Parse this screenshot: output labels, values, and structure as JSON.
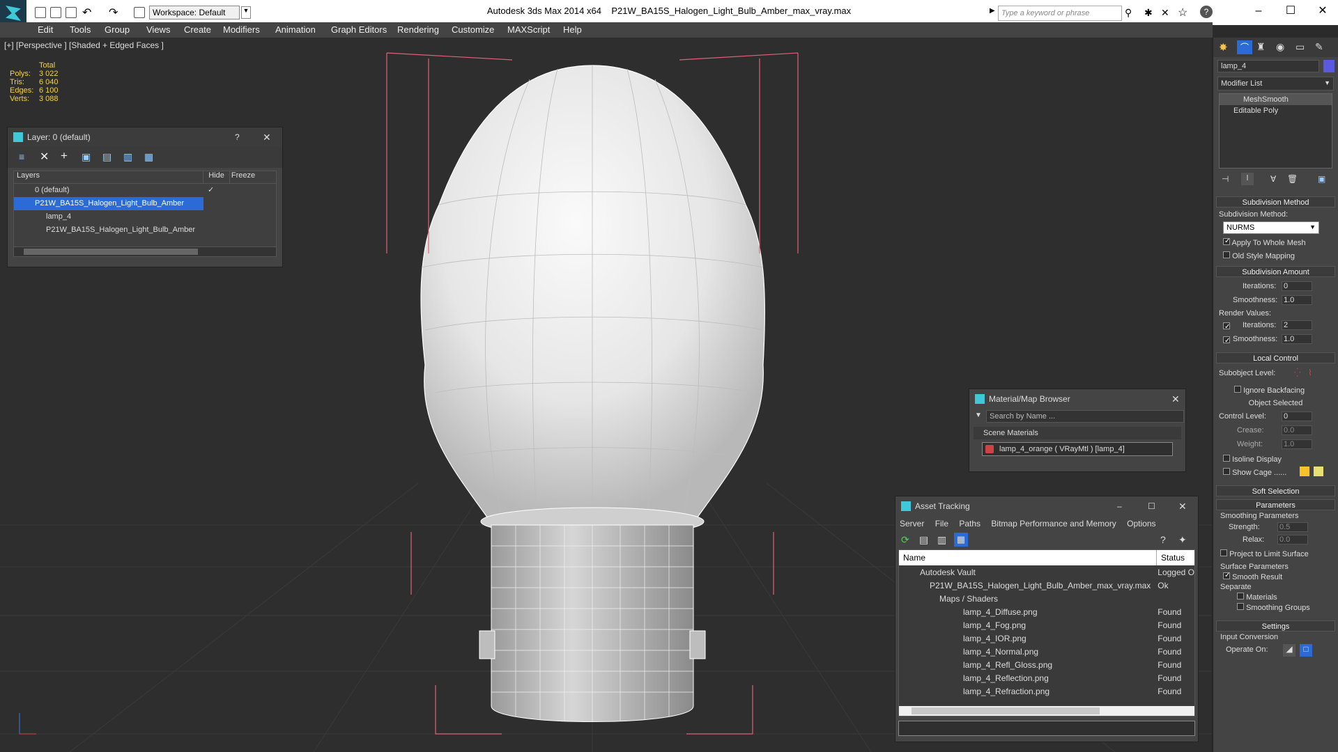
{
  "window": {
    "app_title": "Autodesk 3ds Max  2014 x64",
    "file_title": "P21W_BA15S_Halogen_Light_Bulb_Amber_max_vray.max",
    "workspace": "Workspace: Default",
    "search_placeholder": "Type a keyword or phrase"
  },
  "menubar": [
    "Edit",
    "Tools",
    "Group",
    "Views",
    "Create",
    "Modifiers",
    "Animation",
    "Graph Editors",
    "Rendering",
    "Customize",
    "MAXScript",
    "Help"
  ],
  "viewport": {
    "label": "[+] [Perspective ] [Shaded + Edged Faces ]",
    "stats": {
      "header": "Total",
      "rows": [
        {
          "label": "Polys:",
          "value": "3 022"
        },
        {
          "label": "Tris:",
          "value": "6 040"
        },
        {
          "label": "Edges:",
          "value": "6 100"
        },
        {
          "label": "Verts:",
          "value": "3 088"
        }
      ]
    }
  },
  "layer_dialog": {
    "title": "Layer: 0 (default)",
    "help": "?",
    "columns": [
      "Layers",
      "Hide",
      "Freeze"
    ],
    "rows": [
      {
        "name": "0 (default)"
      },
      {
        "name": "P21W_BA15S_Halogen_Light_Bulb_Amber"
      },
      {
        "name": "lamp_4"
      },
      {
        "name": "P21W_BA15S_Halogen_Light_Bulb_Amber"
      }
    ]
  },
  "material_browser": {
    "title": "Material/Map Browser",
    "search_placeholder": "Search by Name ...",
    "section": "Scene Materials",
    "item": "lamp_4_orange  ( VRayMtl )  [lamp_4]"
  },
  "asset_tracking": {
    "title": "Asset Tracking",
    "menu": [
      "Server",
      "File",
      "Paths",
      "Bitmap Performance and Memory",
      "Options"
    ],
    "columns": [
      "Name",
      "Status"
    ],
    "rows": [
      {
        "name": "Autodesk Vault",
        "status": "Logged O"
      },
      {
        "name": "P21W_BA15S_Halogen_Light_Bulb_Amber_max_vray.max",
        "status": "Ok"
      },
      {
        "name": "Maps / Shaders",
        "status": ""
      },
      {
        "name": "lamp_4_Diffuse.png",
        "status": "Found"
      },
      {
        "name": "lamp_4_Fog.png",
        "status": "Found"
      },
      {
        "name": "lamp_4_IOR.png",
        "status": "Found"
      },
      {
        "name": "lamp_4_Normal.png",
        "status": "Found"
      },
      {
        "name": "lamp_4_Refl_Gloss.png",
        "status": "Found"
      },
      {
        "name": "lamp_4_Reflection.png",
        "status": "Found"
      },
      {
        "name": "lamp_4_Refraction.png",
        "status": "Found"
      }
    ]
  },
  "command_panel": {
    "object_name": "lamp_4",
    "object_color": "#5a5ae0",
    "modifier_list": "Modifier List",
    "stack": [
      "MeshSmooth",
      "Editable Poly"
    ],
    "subdivision_method": {
      "title": "Subdivision Method",
      "label": "Subdivision Method:",
      "value": "NURMS",
      "apply_whole_mesh": "Apply To Whole Mesh",
      "old_style": "Old Style Mapping"
    },
    "subdivision_amount": {
      "title": "Subdivision Amount",
      "iterations_label": "Iterations:",
      "iterations": "0",
      "smoothness_label": "Smoothness:",
      "smoothness": "1.0",
      "render_values": "Render Values:",
      "r_iterations_label": "Iterations:",
      "r_iterations": "2",
      "r_smoothness_label": "Smoothness:",
      "r_smoothness": "1.0"
    },
    "local_control": {
      "title": "Local Control",
      "subobject": "Subobject Level:",
      "ignore_backfacing": "Ignore Backfacing",
      "object_selected": "Object Selected",
      "control_level_label": "Control Level:",
      "control_level": "0",
      "crease_label": "Crease:",
      "crease": "0.0",
      "weight_label": "Weight:",
      "weight": "1.0",
      "isoline": "Isoline Display",
      "show_cage": "Show Cage ......"
    },
    "soft_selection": "Soft Selection",
    "parameters": {
      "title": "Parameters",
      "smoothing": "Smoothing Parameters",
      "strength_label": "Strength:",
      "strength": "0.5",
      "relax_label": "Relax:",
      "relax": "0.0",
      "project": "Project to Limit Surface",
      "surface": "Surface Parameters",
      "smooth_result": "Smooth Result",
      "separate": "Separate",
      "materials": "Materials",
      "smoothing_groups": "Smoothing Groups"
    },
    "settings": {
      "title": "Settings",
      "input_conversion": "Input Conversion",
      "operate_on": "Operate On:"
    }
  }
}
